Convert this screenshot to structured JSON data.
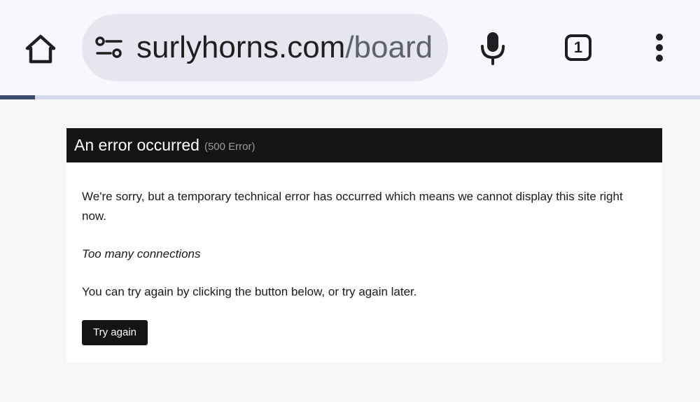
{
  "browser": {
    "url_host": "surlyhorns.com",
    "url_path": "/board",
    "tab_count": "1",
    "progress": 0.05,
    "icons": {
      "home": "home-icon",
      "site_settings": "tune-icon",
      "mic": "microphone-icon",
      "tabs": "tab-switcher-icon",
      "menu": "more-vertical-icon"
    }
  },
  "error_page": {
    "title": "An error occurred",
    "code": "(500 Error)",
    "message": "We're sorry, but a temporary technical error has occurred which means we cannot display this site right now.",
    "detail": "Too many connections",
    "hint": "You can try again by clicking the button below, or try again later.",
    "button_label": "Try again"
  },
  "colors": {
    "toolbar_bg": "#f7f8fd",
    "omnibox_bg": "#e5e6f0",
    "header_bg": "#141414",
    "page_bg": "#f7f7f7",
    "progress_fill": "#3c4a6e",
    "progress_track": "#d5d9ee"
  }
}
